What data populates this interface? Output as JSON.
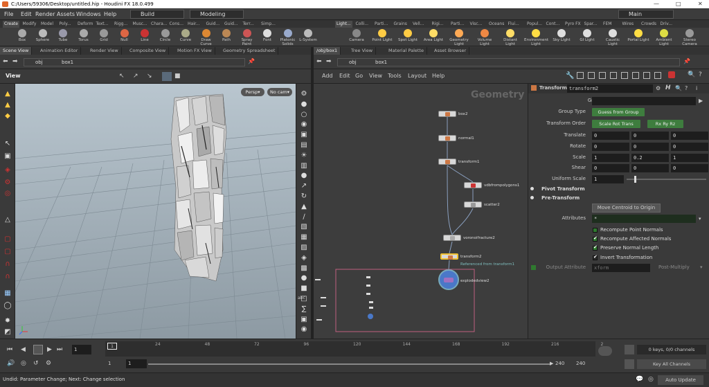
{
  "titlebar": {
    "title": "C:/Users/59306/Desktop/untitled.hip - Houdini FX 18.0.499",
    "min": "—",
    "max": "□",
    "close": "✕"
  },
  "menu": {
    "items": [
      "File",
      "Edit",
      "Render",
      "Assets",
      "Windows",
      "Help"
    ],
    "build": "Build",
    "desktop": "Modeling",
    "main": "Main"
  },
  "shelf_tabs_left": [
    "Create",
    "Modify",
    "Model",
    "Poly...",
    "Deform",
    "Text...",
    "Rigg...",
    "Musc...",
    "Chara...",
    "Cons...",
    "Hair...",
    "Guid...",
    "Guid...",
    "Terr...",
    "Simp..."
  ],
  "shelf_tabs_right": [
    "Light...",
    "Colli...",
    "Parti...",
    "Grains",
    "Vell...",
    "Rigi...",
    "Parti...",
    "Visc...",
    "Oceans",
    "Flui...",
    "Popul...",
    "Cont...",
    "Pyro FX",
    "Spar...",
    "FEM",
    "Wires",
    "Crowds",
    "Driv..."
  ],
  "tools_left": [
    "Box",
    "Sphere",
    "Tube",
    "Torus",
    "Grid",
    "Null",
    "Line",
    "Circle",
    "Curve",
    "Draw Curve",
    "Path",
    "Spray Paint",
    "Font",
    "Platonic Solids",
    "L-System"
  ],
  "tools_right": [
    "Camera",
    "Point Light",
    "Spot Light",
    "Area Light",
    "Geometry Light",
    "Volume Light",
    "Distant Light",
    "Environment Light",
    "Sky Light",
    "GI Light",
    "Caustic Light",
    "Portal Light",
    "Ambient Light",
    "Stereo Camera"
  ],
  "panel_tabs_left": [
    "Scene View",
    "Animation Editor",
    "Render View",
    "Composite View",
    "Motion FX View",
    "Geometry Spreadsheet"
  ],
  "panel_tabs_right": [
    "/obj/box1",
    "Tree View",
    "Material Palette",
    "Asset Browser"
  ],
  "path_left": {
    "obj": "obj",
    "node": "box1"
  },
  "path_right": {
    "obj": "obj",
    "node": "box1"
  },
  "viewport": {
    "label": "View",
    "persp": "Persp▾",
    "cam": "No cam▾"
  },
  "network": {
    "menu": [
      "Add",
      "Edit",
      "Go",
      "View",
      "Tools",
      "Layout",
      "Help"
    ],
    "context": "Geometry",
    "nodes": {
      "box2": "box2",
      "normal1": "normal1",
      "transform1": "transform1",
      "vdb": "vdbfrompolygons1",
      "scatter2": "scatter2",
      "voronoi": "voronoifracture2",
      "transform2": "transform2",
      "ref": "Referenced from transform1",
      "exploded": "explodedview2"
    }
  },
  "params": {
    "type": "Transform",
    "name": "transform2",
    "group_label": "Group",
    "group_value": "",
    "group_type_label": "Group Type",
    "group_type_value": "Guess from Group",
    "xform_order_label": "Transform Order",
    "xform_order_value": "Scale Rot Trans",
    "rot_order_value": "Rx Ry Rz",
    "translate_label": "Translate",
    "translate": [
      "0",
      "0",
      "0"
    ],
    "rotate_label": "Rotate",
    "rotate": [
      "0",
      "0",
      "0"
    ],
    "scale_label": "Scale",
    "scale": [
      "1",
      "0.2",
      "1"
    ],
    "shear_label": "Shear",
    "shear": [
      "0",
      "0",
      "0"
    ],
    "uniform_label": "Uniform Scale",
    "uniform": "1",
    "pivot": "Pivot Transform",
    "pre": "Pre-Transform",
    "move_centroid": "Move Centroid to Origin",
    "attributes_label": "Attributes",
    "attributes_value": "*",
    "chk_points": "Recompute Point Normals",
    "chk_affected": "Recompute Affected Normals",
    "chk_length": "Preserve Normal Length",
    "chk_invert": "Invert Transformation",
    "output_label": "Output Attribute",
    "output_value": "xform",
    "post_mult": "Post-Multiply"
  },
  "timeline": {
    "frame": "1",
    "ticks": [
      "24",
      "48",
      "72",
      "96",
      "120",
      "144",
      "168",
      "192",
      "216",
      "2"
    ],
    "start": "1",
    "start2": "1",
    "end": "240",
    "end2": "240",
    "keys": "0 keys, 0/0 channels",
    "key_all": "Key All Channels"
  },
  "status": {
    "text": "Undid: Parameter Change; Next: Change selection",
    "autoupdate": "Auto Update"
  },
  "colors": {
    "accent": "#3e7d3e",
    "highlight_node": "#f0c030"
  }
}
